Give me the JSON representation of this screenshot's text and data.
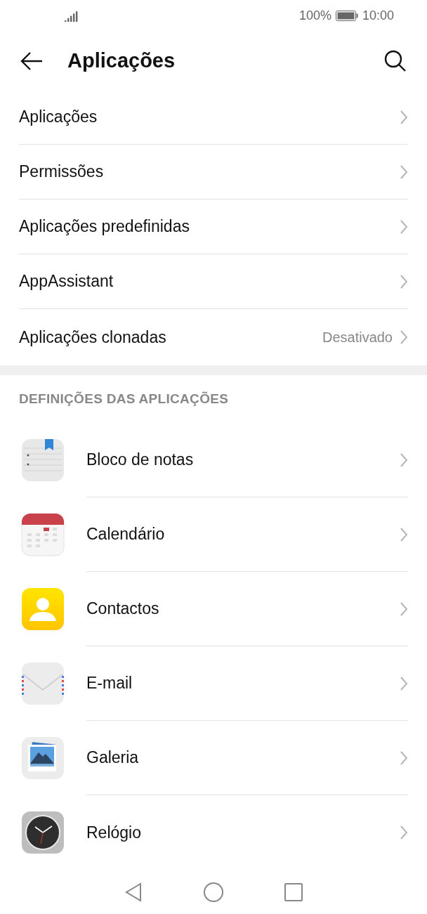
{
  "status_bar": {
    "battery": "100%",
    "time": "10:00"
  },
  "header": {
    "title": "Aplicações"
  },
  "menu": [
    {
      "label": "Aplicações"
    },
    {
      "label": "Permissões"
    },
    {
      "label": "Aplicações predefinidas"
    },
    {
      "label": "AppAssistant"
    },
    {
      "label": "Aplicações clonadas",
      "value": "Desativado"
    }
  ],
  "section": {
    "title": "DEFINIÇÕES DAS APLICAÇÕES"
  },
  "apps": [
    {
      "kind": "notes",
      "label": "Bloco de notas"
    },
    {
      "kind": "calendar",
      "label": "Calendário"
    },
    {
      "kind": "contacts",
      "label": "Contactos"
    },
    {
      "kind": "email",
      "label": "E-mail"
    },
    {
      "kind": "gallery",
      "label": "Galeria"
    },
    {
      "kind": "clock",
      "label": "Relógio"
    }
  ]
}
